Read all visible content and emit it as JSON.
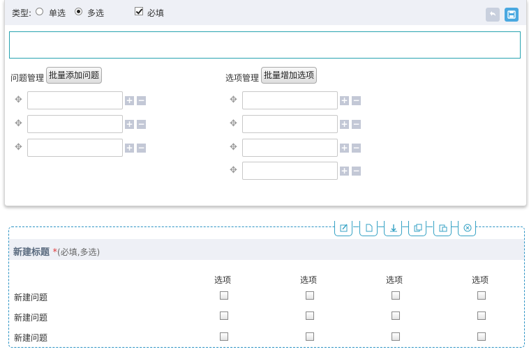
{
  "toolbar": {
    "type_label": "类型:",
    "single_label": "单选",
    "multi_label": "多选",
    "selected_type": "multi",
    "required_label": "必填",
    "required_checked": true,
    "undo_icon": "undo-icon",
    "save_icon": "save-icon"
  },
  "title_input": {
    "value": ""
  },
  "questions": {
    "label": "问题管理",
    "bulk_button": "批量添加问题",
    "rows": [
      "",
      "",
      ""
    ]
  },
  "options": {
    "label": "选项管理",
    "bulk_button": "批量增加选项",
    "rows": [
      "",
      "",
      "",
      ""
    ]
  },
  "preview": {
    "tools": [
      "edit-icon",
      "copy-icon",
      "move-down-icon",
      "duplicate-icon",
      "paste-icon",
      "delete-icon"
    ],
    "title": "新建标题",
    "required_mark": "*",
    "hint": "(必填,多选)",
    "columns": [
      "选项",
      "选项",
      "选项",
      "选项"
    ],
    "rows": [
      "新建问题",
      "新建问题",
      "新建问题"
    ]
  },
  "colors": {
    "accent": "#28a3b0",
    "toolbar_bg": "#eef0f6",
    "save_btn": "#4aa8e0",
    "undo_btn": "#c9d0de",
    "required": "#e03b3b"
  }
}
